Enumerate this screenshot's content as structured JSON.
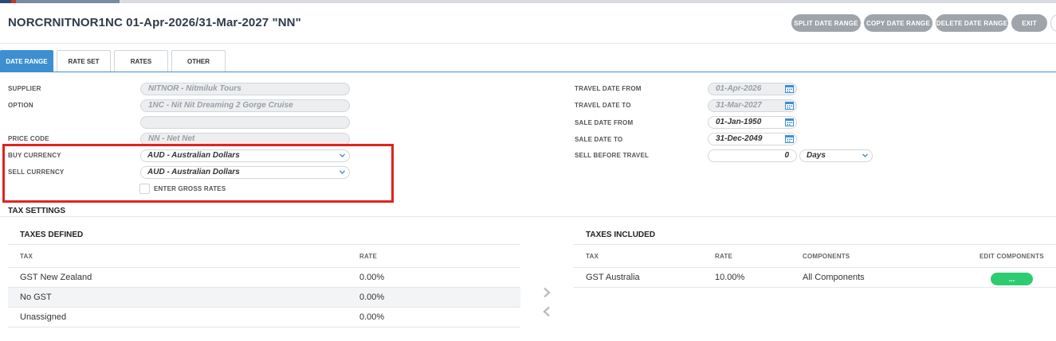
{
  "header": {
    "title": "NORCRNITNOR1NC 01-Apr-2026/31-Mar-2027 \"NN\"",
    "buttons": {
      "split": "SPLIT DATE RANGE",
      "copy": "COPY DATE RANGE",
      "delete": "DELETE DATE RANGE",
      "exit": "EXIT"
    }
  },
  "tabs": [
    "DATE RANGE",
    "RATE SET",
    "RATES",
    "OTHER"
  ],
  "form_left": {
    "supplier_label": "SUPPLIER",
    "supplier_value": "NITNOR - Nitmiluk Tours",
    "option_label": "OPTION",
    "option_value": "1NC - Nit Nit Dreaming 2 Gorge Cruise",
    "option_extra_value": "",
    "price_code_label": "PRICE CODE",
    "price_code_value": "NN - Net Net",
    "buy_currency_label": "BUY CURRENCY",
    "buy_currency_value": "AUD - Australian Dollars",
    "sell_currency_label": "SELL CURRENCY",
    "sell_currency_value": "AUD - Australian Dollars",
    "gross_rates_label": "ENTER GROSS RATES"
  },
  "form_right": {
    "travel_from_label": "TRAVEL DATE FROM",
    "travel_from_value": "01-Apr-2026",
    "travel_to_label": "TRAVEL DATE TO",
    "travel_to_value": "31-Mar-2027",
    "sale_from_label": "SALE DATE FROM",
    "sale_from_value": "01-Jan-1950",
    "sale_to_label": "SALE DATE TO",
    "sale_to_value": "31-Dec-2049",
    "sell_before_label": "SELL BEFORE TRAVEL",
    "sell_before_value": "0",
    "sell_before_unit": "Days"
  },
  "tax_settings": {
    "title": "TAX SETTINGS",
    "defined": {
      "title": "TAXES DEFINED",
      "columns": [
        "TAX",
        "RATE"
      ],
      "rows": [
        {
          "tax": "GST New Zealand",
          "rate": "0.00%"
        },
        {
          "tax": "No GST",
          "rate": "0.00%"
        },
        {
          "tax": "Unassigned",
          "rate": "0.00%"
        }
      ]
    },
    "included": {
      "title": "TAXES INCLUDED",
      "columns": [
        "TAX",
        "RATE",
        "COMPONENTS",
        "EDIT COMPONENTS"
      ],
      "rows": [
        {
          "tax": "GST Australia",
          "rate": "10.00%",
          "components": "All Components",
          "edit": "..."
        }
      ]
    }
  },
  "colors": {
    "accent": "#3d8fd1",
    "highlight": "#e0231f",
    "button_grey": "#9ea4aa",
    "green": "#2ecc71"
  },
  "icons": [
    "calendar-icon",
    "chevron-down-icon",
    "arrow-right-icon",
    "arrow-left-icon"
  ]
}
